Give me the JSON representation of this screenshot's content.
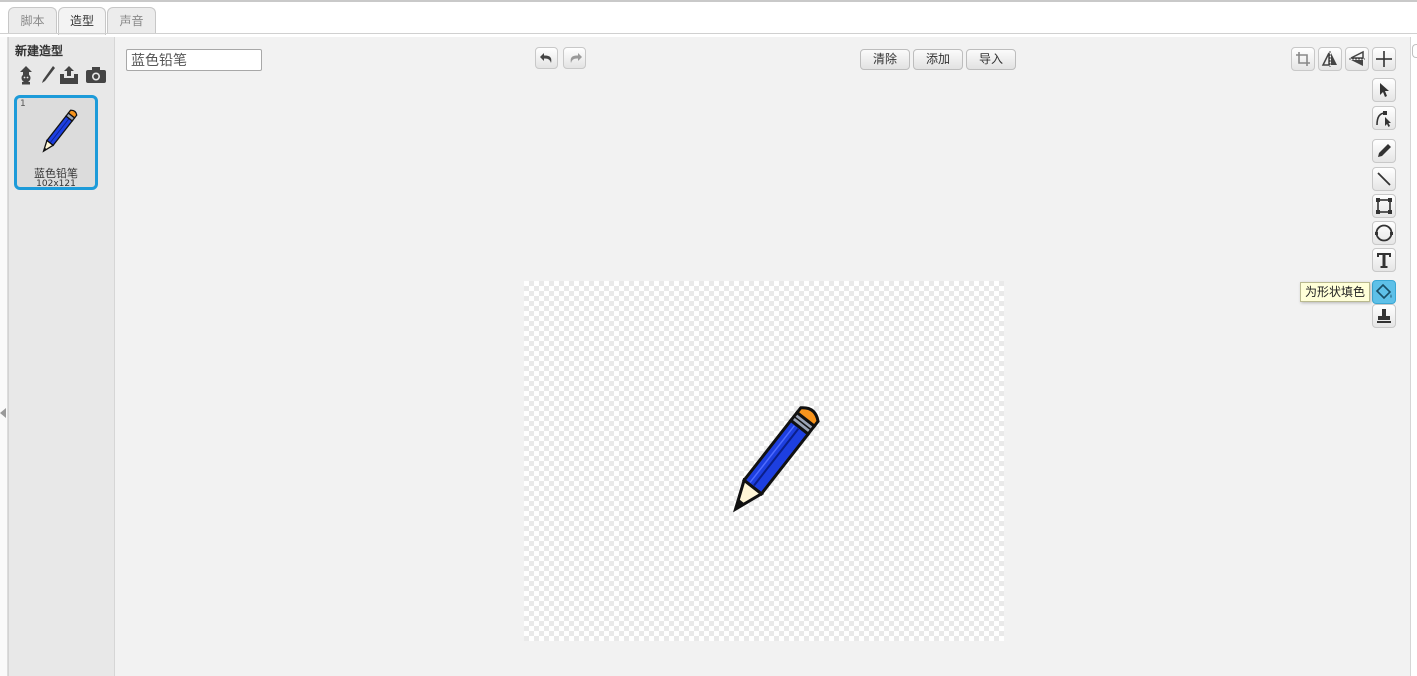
{
  "tabs": [
    {
      "label": "脚本",
      "active": false
    },
    {
      "label": "造型",
      "active": true
    },
    {
      "label": "声音",
      "active": false
    }
  ],
  "sidebar": {
    "new_costume_label": "新建造型",
    "new_costume_icons": [
      "choose-from-library-icon",
      "paint-new-icon",
      "upload-file-icon",
      "camera-icon"
    ],
    "costumes": [
      {
        "number": "1",
        "name": "蓝色铅笔",
        "size": "102x121",
        "selected": true
      }
    ]
  },
  "editor": {
    "costume_name_value": "蓝色铅笔",
    "undo_icon": "undo-icon",
    "redo_icon": "redo-icon",
    "buttons": {
      "clear": "清除",
      "add": "添加",
      "import": "导入"
    },
    "top_tools": [
      "crop-icon",
      "flip-horizontal-icon",
      "flip-vertical-icon",
      "set-costume-center-icon"
    ],
    "side_tools": [
      "select-icon",
      "reshape-icon",
      "pencil-icon",
      "line-icon",
      "rectangle-icon",
      "ellipse-icon",
      "text-icon",
      "fill-icon",
      "stamp-icon"
    ],
    "active_tool": "fill-icon",
    "tooltip": "为形状填色"
  },
  "colors": {
    "accent": "#1d9bd9",
    "active_tool_bg": "#5ec0e8",
    "pencil_body": "#1d3fe0",
    "pencil_eraser": "#f7941d"
  }
}
